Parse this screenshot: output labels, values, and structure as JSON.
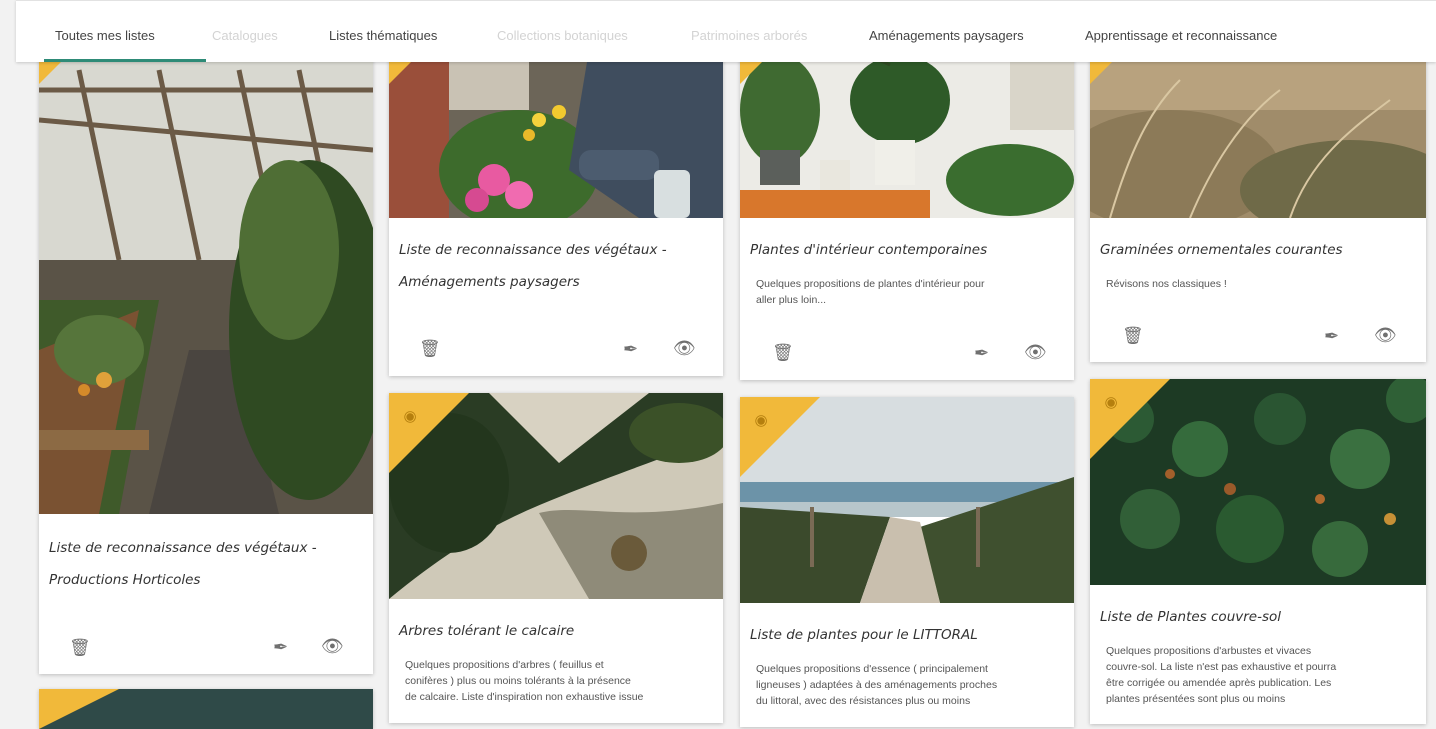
{
  "tabs": [
    {
      "label": "Toutes mes listes",
      "state": "active"
    },
    {
      "label": "Catalogues",
      "state": "disabled"
    },
    {
      "label": "Listes thématiques",
      "state": "normal"
    },
    {
      "label": "Collections botaniques",
      "state": "disabled"
    },
    {
      "label": "Patrimoines arborés",
      "state": "disabled"
    },
    {
      "label": "Aménagements paysagers",
      "state": "normal"
    },
    {
      "label": "Apprentissage et reconnaissance",
      "state": "normal"
    }
  ],
  "colors": {
    "accent": "#2e8b77",
    "ribbon": "#f1b93a",
    "ribbon_icon": "#b57f0e"
  },
  "icons": {
    "delete": "trash-icon",
    "edit": "pen-icon",
    "view": "eye-icon",
    "ribbon": "tag-icon"
  },
  "cards": [
    {
      "title_line1": "Liste de reconnaissance des végétaux -",
      "title_line2": "Productions Horticoles",
      "image": "greenhouse"
    },
    {
      "title_line1": "Liste de reconnaissance des végétaux -",
      "title_line2": "Aménagements paysagers",
      "image": "gardening-flowers"
    },
    {
      "title": "Plantes d'intérieur contemporaines",
      "description": [
        "Quelques propositions de plantes d'intérieur pour",
        "aller plus loin..."
      ],
      "image": "houseplants"
    },
    {
      "title": "Graminées ornementales courantes",
      "description": [
        "Révisons nos classiques !"
      ],
      "image": "grasses"
    },
    {
      "title": "Arbres tolérant le calcaire",
      "description": [
        "Quelques propositions d'arbres ( feuillus et",
        "conifères ) plus ou moins tolérants à la présence",
        "de calcaire. Liste d'inspiration non exhaustive issue"
      ],
      "image": "aerial-forest"
    },
    {
      "title": "Liste de plantes pour le LITTORAL",
      "description": [
        "Quelques propositions d'essence ( principalement",
        "ligneuses ) adaptées à des aménagements proches",
        "du littoral, avec des résistances plus ou moins"
      ],
      "image": "beach-path"
    },
    {
      "title": "Liste de Plantes couvre-sol",
      "description": [
        "Quelques propositions d'arbustes et vivaces",
        "couvre-sol. La liste n'est pas exhaustive et pourra",
        "être corrigée ou amendée après publication. Les",
        "plantes présentées sont plus ou moins"
      ],
      "image": "ivy"
    }
  ]
}
